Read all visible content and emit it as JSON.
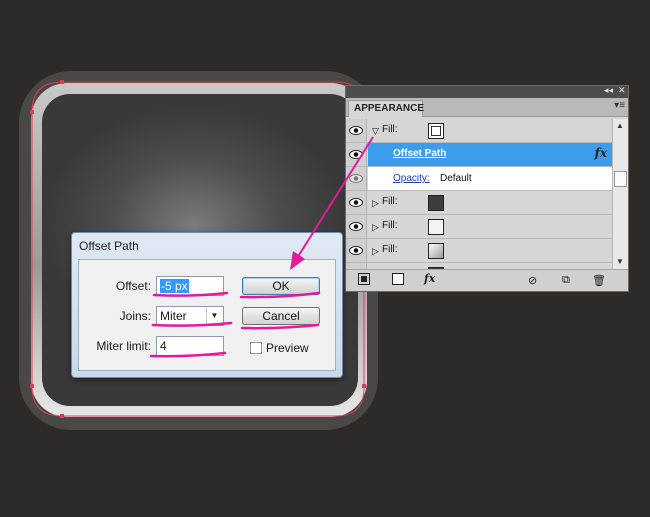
{
  "dialog": {
    "title": "Offset Path",
    "offset_label": "Offset:",
    "offset_value": "-5 px",
    "joins_label": "Joins:",
    "joins_value": "Miter",
    "miter_label": "Miter limit:",
    "miter_value": "4",
    "ok_label": "OK",
    "cancel_label": "Cancel",
    "preview_label": "Preview",
    "preview_checked": false
  },
  "panel": {
    "tab": "APPEARANCE",
    "rows": [
      {
        "kind": "fill",
        "label": "Fill:",
        "expanded": true
      },
      {
        "kind": "effect",
        "label": "Offset Path",
        "selected": true,
        "fx": "fx"
      },
      {
        "kind": "opacity",
        "label": "Opacity:",
        "value": "Default"
      },
      {
        "kind": "fill",
        "label": "Fill:",
        "expanded": false
      },
      {
        "kind": "fill",
        "label": "Fill:",
        "expanded": false
      },
      {
        "kind": "fill",
        "label": "Fill:",
        "expanded": false
      }
    ],
    "footer_fx": "fx"
  },
  "colors": {
    "annotation": "#e6199b",
    "selection_outline": "#e03c52",
    "panel_highlight": "#3d9ded"
  },
  "icons": {
    "eye": "eye-icon",
    "expand": "disclosure-triangle-icon",
    "fx": "fx-icon",
    "new_stroke": "add-new-stroke-icon",
    "new_fill": "add-new-fill-icon",
    "clear": "clear-appearance-icon",
    "duplicate": "duplicate-item-icon",
    "delete": "trash-icon"
  }
}
